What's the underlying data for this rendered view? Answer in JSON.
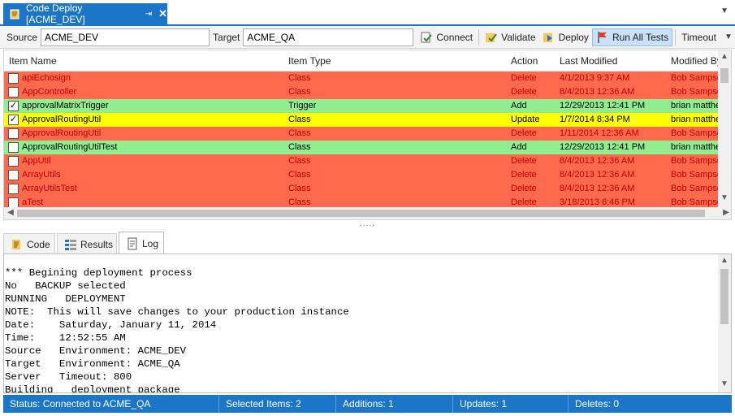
{
  "doc_tab": {
    "title": "Code Deploy [ACME_DEV]",
    "pin_glyph": "⇥",
    "close_glyph": "✕"
  },
  "toolbar": {
    "source_label": "Source",
    "source_value": "ACME_DEV",
    "target_label": "Target",
    "target_value": "ACME_QA",
    "connect_label": "Connect",
    "validate_label": "Validate",
    "deploy_label": "Deploy",
    "run_all_tests_label": "Run All Tests",
    "timeout_label": "Timeout"
  },
  "grid": {
    "columns": [
      "Item Name",
      "Item Type",
      "Action",
      "Last Modified",
      "Modified By"
    ],
    "rows": [
      {
        "checked": false,
        "name": "apiEchosign",
        "type": "Class",
        "action": "Delete",
        "modified": "4/1/2013 9:37 AM",
        "by": "Bob Sampson",
        "color": "#ff6a4d"
      },
      {
        "checked": false,
        "name": "AppController",
        "type": "Class",
        "action": "Delete",
        "modified": "8/4/2013 12:36 AM",
        "by": "Bob Sampson",
        "color": "#ff6a4d"
      },
      {
        "checked": true,
        "name": "approvalMatrixTrigger",
        "type": "Trigger",
        "action": "Add",
        "modified": "12/29/2013 12:41 PM",
        "by": "brian matthews",
        "color": "#90ee90"
      },
      {
        "checked": true,
        "name": "ApprovalRoutingUtil",
        "type": "Class",
        "action": "Update",
        "modified": "1/7/2014 8:34 PM",
        "by": "brian matthews",
        "color": "#ffff00"
      },
      {
        "checked": false,
        "name": "ApprovalRoutingUtil",
        "type": "Class",
        "action": "Delete",
        "modified": "1/11/2014 12:36 AM",
        "by": "Bob Sampson",
        "color": "#ff6a4d"
      },
      {
        "checked": false,
        "name": "ApprovalRoutingUtilTest",
        "type": "Class",
        "action": "Add",
        "modified": "12/29/2013 12:41 PM",
        "by": "brian matthews",
        "color": "#90ee90"
      },
      {
        "checked": false,
        "name": "AppUtil",
        "type": "Class",
        "action": "Delete",
        "modified": "8/4/2013 12:36 AM",
        "by": "Bob Sampson",
        "color": "#ff6a4d"
      },
      {
        "checked": false,
        "name": "ArrayUtils",
        "type": "Class",
        "action": "Delete",
        "modified": "8/4/2013 12:36 AM",
        "by": "Bob Sampson",
        "color": "#ff6a4d"
      },
      {
        "checked": false,
        "name": "ArrayUtilsTest",
        "type": "Class",
        "action": "Delete",
        "modified": "8/4/2013 12:36 AM",
        "by": "Bob Sampson",
        "color": "#ff6a4d"
      },
      {
        "checked": false,
        "name": "aTest",
        "type": "Class",
        "action": "Delete",
        "modified": "3/18/2013 6:46 PM",
        "by": "Bob Sampson",
        "color": "#ff6a4d"
      }
    ]
  },
  "splitter": {
    "grip": "....."
  },
  "bottom_tabs": [
    {
      "label": "Code",
      "icon": "code-icon"
    },
    {
      "label": "Results",
      "icon": "results-icon"
    },
    {
      "label": "Log",
      "icon": "log-icon",
      "selected": true
    }
  ],
  "log": {
    "lines": [
      "*** Begining deployment process",
      "No   BACKUP selected",
      "RUNNING   DEPLOYMENT",
      "NOTE:  This will save changes to your production instance",
      "Date:    Saturday, January 11, 2014",
      "Time:    12:52:55 AM",
      "Source   Environment: ACME_DEV",
      "Target   Environment: ACME_QA",
      "Server   Timeout: 800",
      "Building   deployment package"
    ]
  },
  "status": {
    "connection": "Status: Connected to ACME_QA",
    "selected": "Selected Items: 2",
    "additions": "Additions: 1",
    "updates": "Updates: 1",
    "deletes": "Deletes: 0"
  },
  "colors": {
    "accent": "#1c76c8",
    "delete": "#ff6a4d",
    "add": "#90ee90",
    "update": "#ffff00",
    "delete_text": "#c00000"
  }
}
